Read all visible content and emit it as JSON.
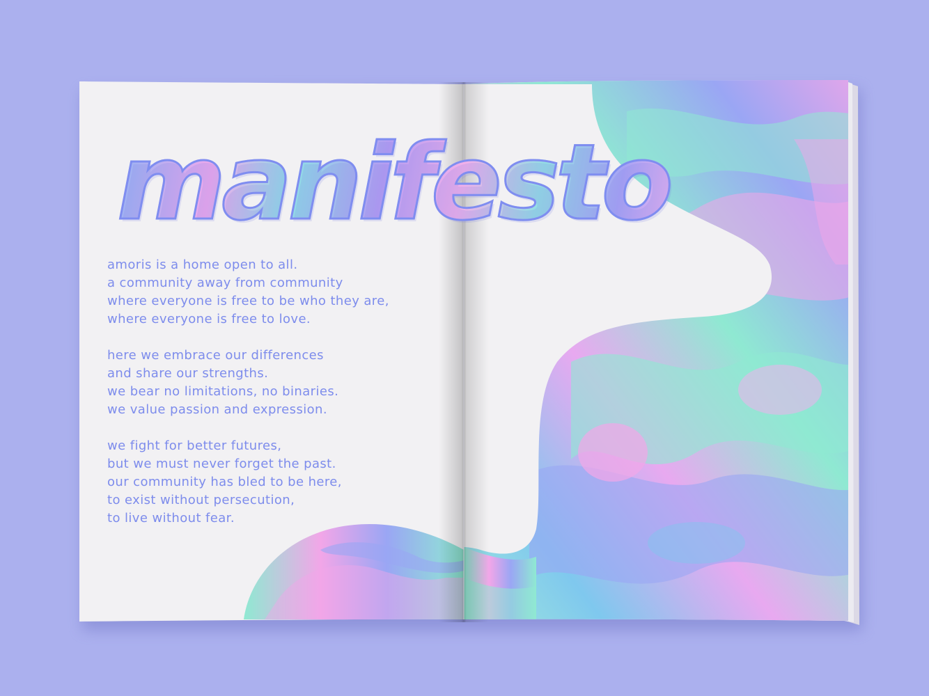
{
  "colors": {
    "background": "#abb0ee",
    "page": "#f2f1f3",
    "text": "#7d8cec",
    "holo_pink": "#f2a6e8",
    "holo_mint": "#8fe9d2",
    "holo_blue": "#9aa6f4",
    "holo_cyan": "#7fd4ea"
  },
  "spread": {
    "title": "manifesto",
    "stanzas": [
      [
        "amoris is a home open to all.",
        "a community away from community",
        "where everyone is free to be who they are,",
        "where everyone is free to love."
      ],
      [
        "here we embrace our differences",
        "and share our strengths.",
        "we bear no limitations, no binaries.",
        "we value passion and expression."
      ],
      [
        "we fight for better futures,",
        "but we must never forget the past.",
        "our community has bled to be here,",
        "to exist without persecution,",
        "to live without fear."
      ]
    ]
  }
}
